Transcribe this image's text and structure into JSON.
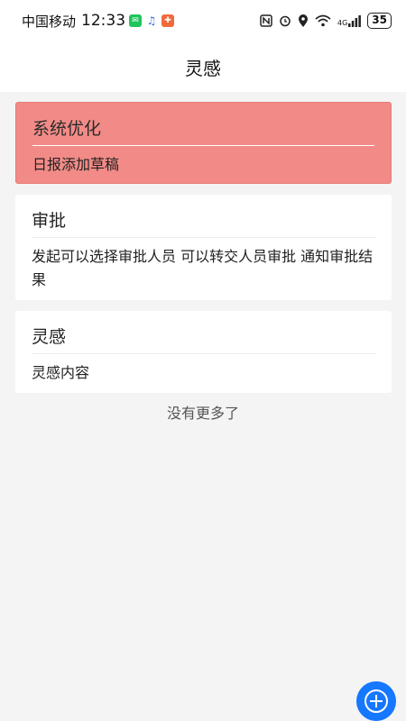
{
  "status_bar": {
    "carrier": "中国移动",
    "time": "12:33",
    "battery": "35",
    "network": "4G"
  },
  "header": {
    "title": "灵感"
  },
  "cards": [
    {
      "title": "系统优化",
      "body": "日报添加草稿",
      "highlighted": true
    },
    {
      "title": "审批",
      "body": "发起可以选择审批人员 可以转交人员审批 通知审批结果",
      "highlighted": false
    },
    {
      "title": "灵感",
      "body": "灵感内容",
      "highlighted": false
    }
  ],
  "footer_text": "没有更多了",
  "colors": {
    "highlight_card": "#f28b87",
    "fab": "#1677ff",
    "background": "#f4f4f4"
  },
  "icons": {
    "fab": "add-circle-icon"
  }
}
